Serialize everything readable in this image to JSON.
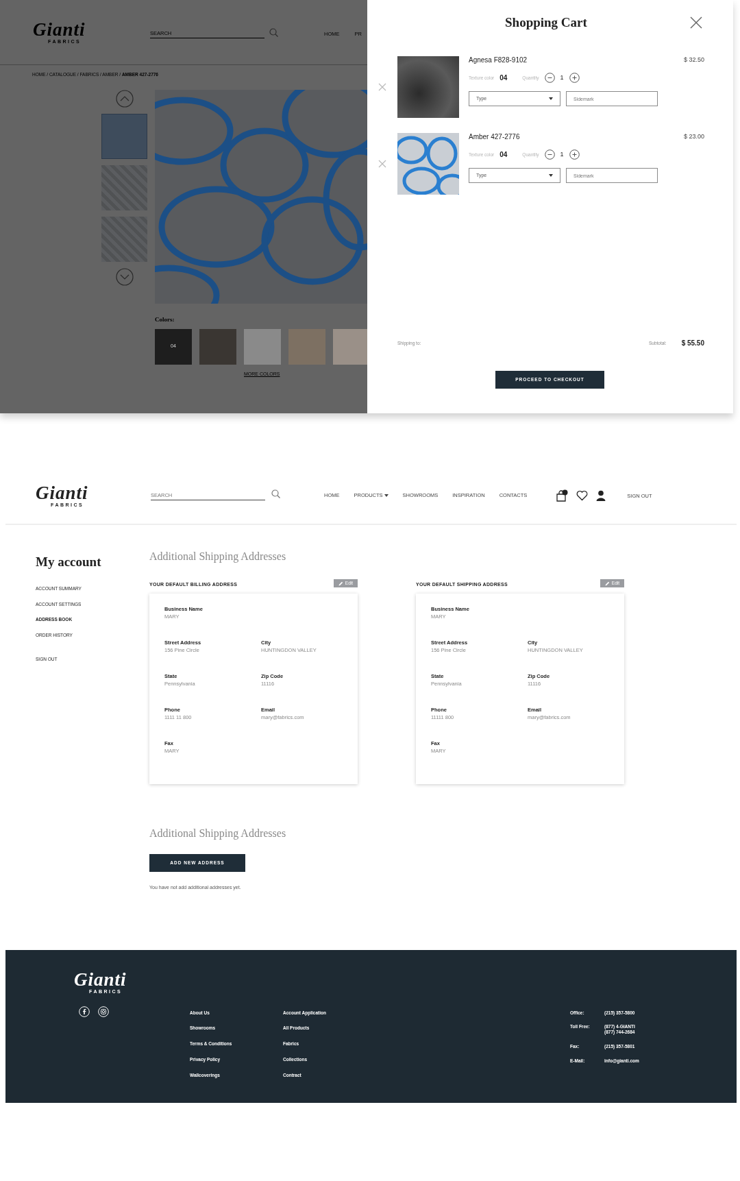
{
  "product_page": {
    "logo": {
      "wordmark": "Gianti",
      "tagline": "FABRICS"
    },
    "search": {
      "placeholder": "SEARCH"
    },
    "nav": [
      "HOME",
      "PR"
    ],
    "breadcrumb": "HOME / CATALOGUE / FABRICS / AMBER / **AMBER 427-2776**",
    "thumbnails": [
      {
        "kind": "loops"
      },
      {
        "kind": "lattice"
      },
      {
        "kind": "lattice"
      }
    ],
    "colors_label": "Colors:",
    "swatches": [
      {
        "label": "04",
        "color": "#1e1e1e"
      },
      {
        "color": "#3a3632"
      },
      {
        "color": "#8a8a8a"
      },
      {
        "color": "#7d7062"
      },
      {
        "color": "#9a9088"
      }
    ],
    "more_colors": "MORE COLORS"
  },
  "cart": {
    "title": "Shopping Cart",
    "items": [
      {
        "kind": "dark",
        "name": "Agnesa F828-9102",
        "price": "$ 32.50",
        "color_label": "Texture color",
        "color_value": "04",
        "quantity_label": "Quantity",
        "quantity": "1",
        "type": "Type",
        "sidemark": {
          "placeholder": "Sidemark"
        }
      },
      {
        "kind": "blue",
        "name": "Amber 427-2776",
        "price": "$ 23.00",
        "color_label": "Texture color",
        "color_value": "04",
        "quantity_label": "Quantity",
        "quantity": "1",
        "type": "Type",
        "sidemark": {
          "placeholder": "Sidemark"
        }
      }
    ],
    "shipping_label": "Shipping to:",
    "subtotal_label": "Subtotal:",
    "subtotal": "$ 55.50",
    "checkout": "PROCEED TO CHECKOUT"
  },
  "header": {
    "logo": {
      "wordmark": "Gianti",
      "tagline": "FABRICS"
    },
    "search": {
      "placeholder": "SEARCH"
    },
    "nav": [
      {
        "label": "HOME",
        "dropdown": false
      },
      {
        "label": "PRODUCTS",
        "dropdown": true
      },
      {
        "label": "SHOWROOMS",
        "dropdown": false
      },
      {
        "label": "INSPIRATION",
        "dropdown": false
      },
      {
        "label": "CONTACTS",
        "dropdown": false
      }
    ],
    "sign_out": "SIGN OUT"
  },
  "sidebar": {
    "title": "My account",
    "items": [
      {
        "label": "ACCOUNT SUMMARY",
        "selected": false
      },
      {
        "label": "ACCOUNT SETTINGS",
        "selected": false
      },
      {
        "label": "ADDRESS BOOK",
        "selected": true
      },
      {
        "label": "ORDER HISTORY",
        "selected": false
      }
    ],
    "sign_out": "SIGN OUT"
  },
  "main": {
    "heading": "Additional Shipping Addresses",
    "cards": [
      {
        "title": "YOUR DEFAULT BILLING ADDRESS",
        "edit": "Edit",
        "rows": [
          [
            {
              "label": "Business Name",
              "value": "MARY"
            }
          ],
          [
            {
              "label": "Street Address",
              "value": "156 Pine Circle"
            },
            {
              "label": "City",
              "value": "HUNTINGDON VALLEY"
            }
          ],
          [
            {
              "label": "State",
              "value": "Pennsylvania"
            },
            {
              "label": "Zip Code",
              "value": "11116"
            }
          ],
          [
            {
              "label": "Phone",
              "value": "1111 11 800"
            },
            {
              "label": "Email",
              "value": "mary@fabrics.com"
            }
          ],
          [
            {
              "label": "Fax",
              "value": "MARY"
            }
          ]
        ]
      },
      {
        "title": "YOUR DEFAULT SHIPPING ADDRESS",
        "edit": "Edit",
        "rows": [
          [
            {
              "label": "Business Name",
              "value": "MARY"
            }
          ],
          [
            {
              "label": "Street Address",
              "value": "156 Pine Circle"
            },
            {
              "label": "City",
              "value": "HUNTINGDON VALLEY"
            }
          ],
          [
            {
              "label": "State",
              "value": "Pennsylvania"
            },
            {
              "label": "Zip Code",
              "value": "11116"
            }
          ],
          [
            {
              "label": "Phone",
              "value": "11111 800"
            },
            {
              "label": "Email",
              "value": "mary@fabrics.com"
            }
          ],
          [
            {
              "label": "Fax",
              "value": "MARY"
            }
          ]
        ]
      }
    ],
    "additional_heading": "Additional Shipping Addresses",
    "add_button": "ADD NEW ADDRESS",
    "empty_note": "You have not add additional addresses yet."
  },
  "footer": {
    "logo": {
      "wordmark": "Gianti",
      "tagline": "FABRICS"
    },
    "link_columns": [
      [
        "About Us",
        "Showrooms",
        "Terms & Conditions",
        "Privacy Policy",
        "Wallcoverings"
      ],
      [
        "Account Application",
        "All Products",
        "Fabrics",
        "Collections",
        "Contract"
      ]
    ],
    "contacts": [
      {
        "label": "Office:",
        "values": [
          "(215) 357-5800"
        ]
      },
      {
        "label": "Toll Free:",
        "values": [
          "(877) 4-GIANTI",
          "(877) 744-2684"
        ]
      },
      {
        "label": "Fax:",
        "values": [
          "(215) 357-5801"
        ]
      },
      {
        "label": "E-Mail:",
        "values": [
          "info@gianti.com"
        ]
      }
    ]
  }
}
